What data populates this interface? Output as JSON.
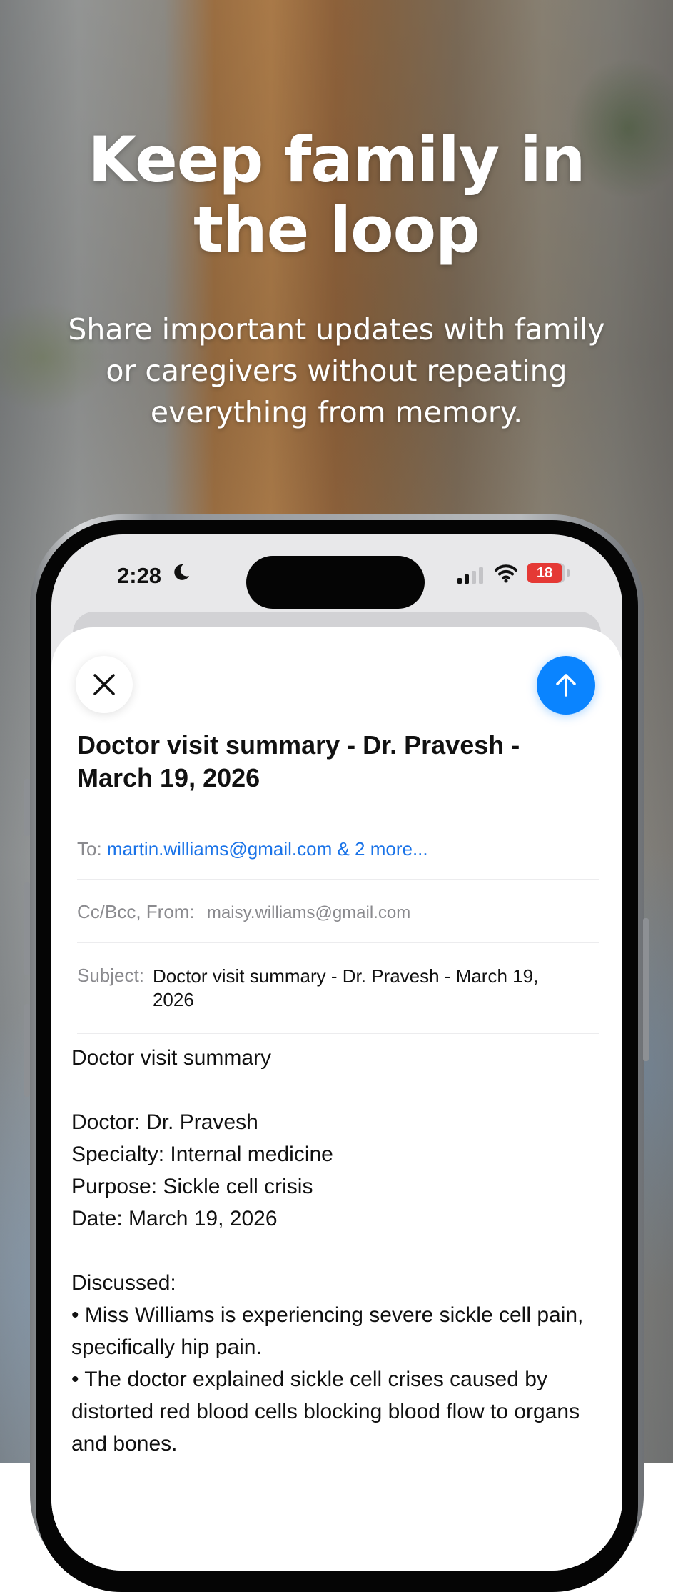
{
  "hero": {
    "title": "Keep family in the loop",
    "subtitle": "Share important updates with family or caregivers without repeating everything from memory."
  },
  "status_bar": {
    "time": "2:28",
    "battery": "18",
    "icons": [
      "moon-icon",
      "signal-icon",
      "wifi-icon",
      "battery-icon"
    ]
  },
  "compose": {
    "close_icon": "close-icon",
    "send_icon": "arrow-up-icon",
    "accent_color": "#0a84ff",
    "title": "Doctor visit summary - Dr. Pravesh - March 19, 2026",
    "to_label": "To:",
    "to_value": "martin.williams@gmail.com & 2 more...",
    "ccbcc_label": "Cc/Bcc, From:",
    "from_value": "maisy.williams@gmail.com",
    "subject_label": "Subject:",
    "subject_value": "Doctor visit summary - Dr. Pravesh - March 19, 2026",
    "body": "Doctor visit summary\n\nDoctor: Dr. Pravesh\nSpecialty: Internal medicine\nPurpose: Sickle cell crisis\nDate: March 19, 2026\n\nDiscussed:\n• Miss Williams is experiencing severe sickle cell pain, specifically hip pain.\n• The doctor explained sickle cell crises caused by distorted red blood cells blocking blood flow to organs and bones."
  }
}
